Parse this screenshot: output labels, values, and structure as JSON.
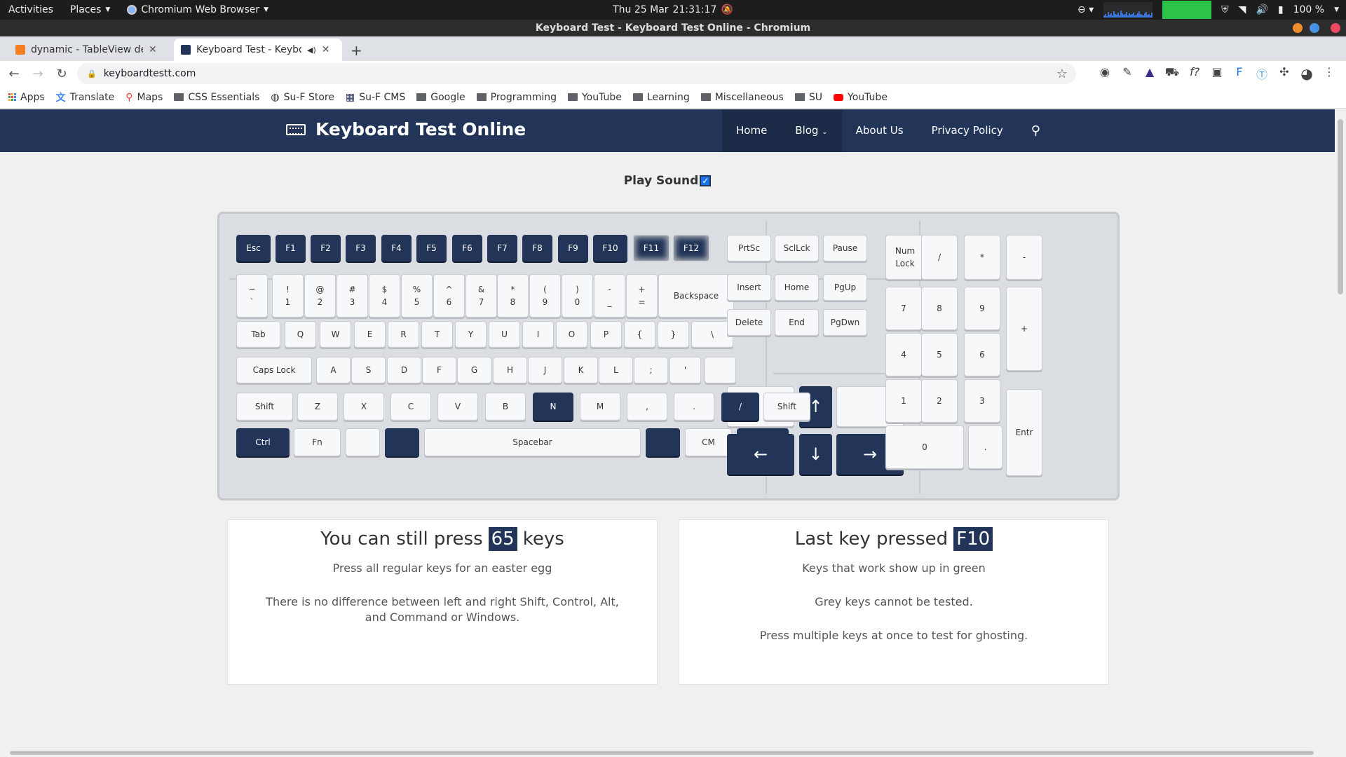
{
  "os_bar": {
    "activities": "Activities",
    "places": "Places",
    "app_name": "Chromium Web Browser",
    "date": "Thu 25 Mar",
    "time": "21:31:17",
    "battery": "100 %"
  },
  "window": {
    "title": "Keyboard Test - Keyboard Test Online - Chromium"
  },
  "tabs": [
    {
      "title": "dynamic - TableView dele",
      "active": false
    },
    {
      "title": "Keyboard Test - Keybo",
      "active": true
    }
  ],
  "address": {
    "url": "keyboardtestt.com"
  },
  "bookmarks": [
    {
      "label": "Apps",
      "icon": "apps-grid-icon"
    },
    {
      "label": "Translate",
      "icon": "translate-icon"
    },
    {
      "label": "Maps",
      "icon": "maps-pin-icon"
    },
    {
      "label": "CSS Essentials",
      "icon": "folder-icon"
    },
    {
      "label": "Su-F Store",
      "icon": "globe-icon"
    },
    {
      "label": "Su-F CMS",
      "icon": "cms-icon"
    },
    {
      "label": "Google",
      "icon": "folder-icon"
    },
    {
      "label": "Programming",
      "icon": "folder-icon"
    },
    {
      "label": "YouTube",
      "icon": "folder-icon"
    },
    {
      "label": "Learning",
      "icon": "folder-icon"
    },
    {
      "label": "Miscellaneous",
      "icon": "folder-icon"
    },
    {
      "label": "SU",
      "icon": "folder-icon"
    },
    {
      "label": "YouTube",
      "icon": "youtube-icon"
    }
  ],
  "site": {
    "logo_text": "Keyboard Test Online",
    "menu": [
      "Home",
      "Blog",
      "About Us",
      "Privacy Policy"
    ],
    "play_sound_label": "Play Sound",
    "play_sound_checked": true
  },
  "keyboard": {
    "keys": [
      {
        "label": "Esc",
        "state": "pressed"
      },
      {
        "label": "F1",
        "state": "pressed"
      },
      {
        "label": "F2",
        "state": "pressed"
      },
      {
        "label": "F3",
        "state": "pressed"
      },
      {
        "label": "F4",
        "state": "pressed"
      },
      {
        "label": "F5",
        "state": "pressed"
      },
      {
        "label": "F6",
        "state": "pressed"
      },
      {
        "label": "F7",
        "state": "pressed"
      },
      {
        "label": "F8",
        "state": "pressed"
      },
      {
        "label": "F9",
        "state": "pressed"
      },
      {
        "label": "F10",
        "state": "pressed"
      },
      {
        "label": "F11",
        "state": "grey"
      },
      {
        "label": "F12",
        "state": "grey"
      },
      {
        "label": "PrtSc",
        "state": "normal"
      },
      {
        "label": "SclLck",
        "state": "normal"
      },
      {
        "label": "Pause",
        "state": "normal"
      },
      {
        "label": "Num\nLock",
        "state": "normal"
      },
      {
        "label": "/",
        "state": "normal"
      },
      {
        "label": "*",
        "state": "normal"
      },
      {
        "label": "-",
        "state": "normal"
      },
      {
        "label": "~\n`",
        "state": "normal"
      },
      {
        "label": "!\n1",
        "state": "normal"
      },
      {
        "label": "@\n2",
        "state": "normal"
      },
      {
        "label": "#\n3",
        "state": "normal"
      },
      {
        "label": "$\n4",
        "state": "normal"
      },
      {
        "label": "%\n5",
        "state": "normal"
      },
      {
        "label": "^\n6",
        "state": "normal"
      },
      {
        "label": "&\n7",
        "state": "normal"
      },
      {
        "label": "*\n8",
        "state": "normal"
      },
      {
        "label": "(\n9",
        "state": "normal"
      },
      {
        "label": ")\n0",
        "state": "normal"
      },
      {
        "label": "-\n_",
        "state": "normal"
      },
      {
        "label": "+\n=",
        "state": "normal"
      },
      {
        "label": "Backspace",
        "state": "normal"
      },
      {
        "label": "Insert",
        "state": "normal"
      },
      {
        "label": "Home",
        "state": "normal"
      },
      {
        "label": "PgUp",
        "state": "normal"
      },
      {
        "label": "7",
        "state": "normal"
      },
      {
        "label": "8",
        "state": "normal"
      },
      {
        "label": "9",
        "state": "normal"
      },
      {
        "label": "+",
        "state": "normal"
      },
      {
        "label": "Tab",
        "state": "normal"
      },
      {
        "label": "Q",
        "state": "normal"
      },
      {
        "label": "W",
        "state": "normal"
      },
      {
        "label": "E",
        "state": "normal"
      },
      {
        "label": "R",
        "state": "normal"
      },
      {
        "label": "T",
        "state": "normal"
      },
      {
        "label": "Y",
        "state": "normal"
      },
      {
        "label": "U",
        "state": "normal"
      },
      {
        "label": "I",
        "state": "normal"
      },
      {
        "label": "O",
        "state": "normal"
      },
      {
        "label": "P",
        "state": "normal"
      },
      {
        "label": "{",
        "state": "normal"
      },
      {
        "label": "}",
        "state": "normal"
      },
      {
        "label": "\\",
        "state": "normal"
      },
      {
        "label": "Delete",
        "state": "normal"
      },
      {
        "label": "End",
        "state": "normal"
      },
      {
        "label": "PgDwn",
        "state": "normal"
      },
      {
        "label": "4",
        "state": "normal"
      },
      {
        "label": "5",
        "state": "normal"
      },
      {
        "label": "6",
        "state": "normal"
      },
      {
        "label": "Caps Lock",
        "state": "normal"
      },
      {
        "label": "A",
        "state": "normal"
      },
      {
        "label": "S",
        "state": "normal"
      },
      {
        "label": "D",
        "state": "normal"
      },
      {
        "label": "F",
        "state": "normal"
      },
      {
        "label": "G",
        "state": "normal"
      },
      {
        "label": "H",
        "state": "normal"
      },
      {
        "label": "J",
        "state": "normal"
      },
      {
        "label": "K",
        "state": "normal"
      },
      {
        "label": "L",
        "state": "normal"
      },
      {
        "label": ";",
        "state": "normal"
      },
      {
        "label": "'",
        "state": "normal"
      },
      {
        "label": "",
        "state": "normal"
      },
      {
        "label": "",
        "state": "normal"
      },
      {
        "label": "↑",
        "state": "pressed"
      },
      {
        "label": "",
        "state": "normal"
      },
      {
        "label": "1",
        "state": "normal"
      },
      {
        "label": "2",
        "state": "normal"
      },
      {
        "label": "3",
        "state": "normal"
      },
      {
        "label": "Entr",
        "state": "normal"
      },
      {
        "label": "Shift",
        "state": "normal"
      },
      {
        "label": "Z",
        "state": "normal"
      },
      {
        "label": "X",
        "state": "normal"
      },
      {
        "label": "C",
        "state": "normal"
      },
      {
        "label": "V",
        "state": "normal"
      },
      {
        "label": "B",
        "state": "normal"
      },
      {
        "label": "N",
        "state": "pressed"
      },
      {
        "label": "M",
        "state": "normal"
      },
      {
        "label": ",",
        "state": "normal"
      },
      {
        "label": ".",
        "state": "normal"
      },
      {
        "label": "/",
        "state": "pressed"
      },
      {
        "label": "Shift",
        "state": "normal"
      },
      {
        "label": "Ctrl",
        "state": "pressed"
      },
      {
        "label": "Fn",
        "state": "normal"
      },
      {
        "label": "",
        "state": "normal"
      },
      {
        "label": "",
        "state": "pressed"
      },
      {
        "label": "Spacebar",
        "state": "normal"
      },
      {
        "label": "",
        "state": "pressed"
      },
      {
        "label": "CM",
        "state": "normal"
      },
      {
        "label": "Ctrl",
        "state": "pressed"
      },
      {
        "label": "←",
        "state": "pressed"
      },
      {
        "label": "↓",
        "state": "pressed"
      },
      {
        "label": "→",
        "state": "pressed"
      },
      {
        "label": "0",
        "state": "normal"
      },
      {
        "label": ".",
        "state": "normal"
      }
    ]
  },
  "cards": {
    "left": {
      "title_pre": "You can still press",
      "count": "65",
      "title_post": "keys",
      "line1": "Press all regular keys for an easter egg",
      "line2": "There is no difference between left and right Shift, Control, Alt, and Command or Windows."
    },
    "right": {
      "title_pre": "Last key pressed",
      "last_key": "F10",
      "line1": "Keys that work show up in green",
      "line2": "Grey keys cannot be tested.",
      "line3": "Press multiple keys at once to test for ghosting."
    }
  }
}
